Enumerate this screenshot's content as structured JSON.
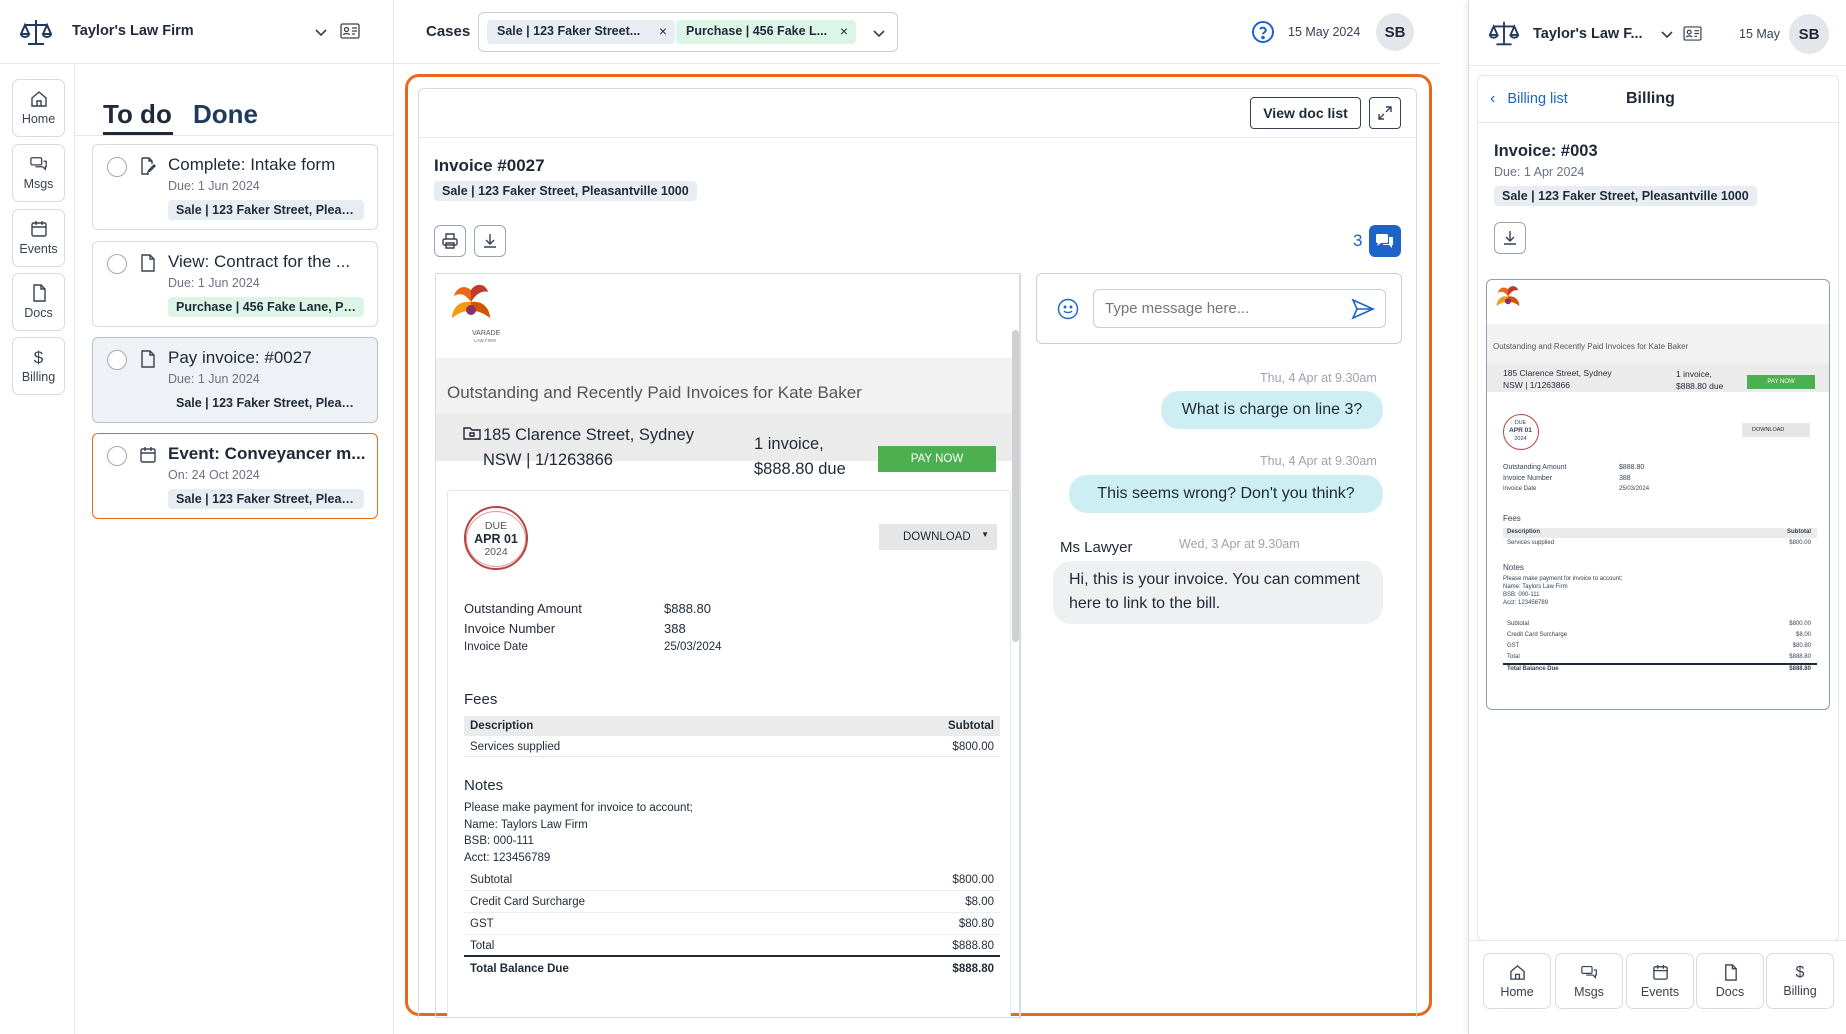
{
  "app": {
    "firm_name": "Taylor's Law Firm",
    "date": "15 May 2024",
    "avatar": "SB"
  },
  "colors": {
    "accent": "#e8691c",
    "brand": "#1f3a5f",
    "link": "#1c64c8",
    "bubble": "#cdeef2",
    "pay": "#4caf50"
  },
  "icons": {
    "logo": "scales-icon",
    "contact": "contact-card-icon",
    "help": "help-circle-icon"
  },
  "header": {
    "cases_label": "Cases",
    "case_chips": [
      {
        "label": "Sale | 123 Faker Street..."
      },
      {
        "label": "Purchase | 456 Fake L..."
      }
    ]
  },
  "nav": {
    "items": [
      {
        "label": "Home"
      },
      {
        "label": "Msgs"
      },
      {
        "label": "Events"
      },
      {
        "label": "Docs"
      },
      {
        "label": "Billing"
      }
    ]
  },
  "todo": {
    "tab_todo": "To do",
    "tab_done": "Done",
    "items": [
      {
        "title": "Complete: Intake form",
        "due": "Due: 1 Jun 2024",
        "tag": "Sale | 123 Faker Street, Pleas..."
      },
      {
        "title": "View: Contract for the ...",
        "due": "Due: 1 Jun 2024",
        "tag": "Purchase | 456 Fake Lane, Pl..."
      },
      {
        "title": "Pay invoice: #0027",
        "due": "Due: 1 Jun 2024",
        "tag": "Sale | 123 Faker Street, Pleas..."
      },
      {
        "title": "Event: Conveyancer m...",
        "due": "On: 24 Oct 2024",
        "tag": "Sale | 123 Faker Street, Pleasa..."
      }
    ]
  },
  "invoice": {
    "view_doc_list": "View doc list",
    "title": "Invoice #0027",
    "tag": "Sale | 123 Faker Street, Pleasantville 1000",
    "comment_count": "3",
    "logo_text": "VARADE",
    "logo_sub": "LAW FIRM",
    "doc": {
      "heading": "Outstanding and Recently Paid Invoices for Kate Baker",
      "address": "185 Clarence Street, Sydney NSW | 1/1263866",
      "summary": "1 invoice, $888.80 due",
      "pay_now": "PAY NOW",
      "due_label": "DUE",
      "due_date": "APR 01",
      "due_year": "2024",
      "download": "DOWNLOAD",
      "outstanding_label": "Outstanding Amount",
      "outstanding_value": "$888.80",
      "invoice_number_label": "Invoice Number",
      "invoice_number_value": "388",
      "invoice_date_label": "Invoice Date",
      "invoice_date_value": "25/03/2024",
      "fees_heading": "Fees",
      "fees_col_desc": "Description",
      "fees_col_sub": "Subtotal",
      "fee_row_desc": "Services supplied",
      "fee_row_value": "$800.00",
      "notes_heading": "Notes",
      "notes_lines": [
        "Please make payment for invoice to account;",
        "Name: Taylors Law Firm",
        "BSB: 000-111",
        "Acct: 123456789"
      ],
      "totals": [
        {
          "label": "Subtotal",
          "value": "$800.00"
        },
        {
          "label": "Credit Card Surcharge",
          "value": "$8.00"
        },
        {
          "label": "GST",
          "value": "$80.80"
        },
        {
          "label": "Total",
          "value": "$888.80"
        }
      ],
      "balance_label": "Total Balance Due",
      "balance_value": "$888.80"
    }
  },
  "chat": {
    "placeholder": "Type message here...",
    "messages": [
      {
        "time": "Thu, 4 Apr at 9.30am",
        "text": "What is charge on line 3?"
      },
      {
        "time": "Thu, 4 Apr at 9.30am",
        "text": "This seems wrong? Don't you think?"
      },
      {
        "sender": "Ms Lawyer",
        "time": "Wed, 3 Apr at 9.30am",
        "text": "Hi, this is your invoice. You can comment here to link to the bill."
      }
    ]
  },
  "mobile": {
    "firm_name": "Taylor's Law F...",
    "date": "15 May",
    "avatar": "SB",
    "back_label": "Billing list",
    "page_title": "Billing",
    "invoice_title": "Invoice: #003",
    "due": "Due: 1 Apr 2024",
    "tag": "Sale | 123 Faker Street, Pleasantville 1000",
    "mini": {
      "heading": "Outstanding and Recently Paid Invoices for Kate Baker",
      "address1": "185 Clarence Street, Sydney",
      "address2": "NSW | 1/1263866",
      "summary1": "1 invoice,",
      "summary2": "$888.80 due",
      "pay_now": "PAY NOW",
      "due_label": "DUE",
      "due_date": "APR 01",
      "due_year": "2024",
      "download": "DOWNLOAD",
      "rows": [
        {
          "label": "Outstanding Amount",
          "value": "$888.80"
        },
        {
          "label": "Invoice Number",
          "value": "388"
        },
        {
          "label": "Invoice Date",
          "value": "25/03/2024"
        }
      ],
      "fees": "Fees",
      "desc": "Description",
      "subtotal": "Subtotal",
      "service": "Services supplied",
      "service_value": "$800.00",
      "notes": "Notes",
      "notes_lines": [
        "Please make payment for invoice to account;",
        "Name: Taylors Law Firm",
        "BSB: 000-111",
        "Acct: 123456789"
      ],
      "totals": [
        {
          "label": "Subtotal",
          "value": "$800.00"
        },
        {
          "label": "Credit Card Surcharge",
          "value": "$8.00"
        },
        {
          "label": "GST",
          "value": "$80.80"
        },
        {
          "label": "Total",
          "value": "$888.80"
        }
      ],
      "balance_label": "Total Balance Due",
      "balance_value": "$888.80"
    },
    "bottom_nav": [
      {
        "label": "Home"
      },
      {
        "label": "Msgs"
      },
      {
        "label": "Events"
      },
      {
        "label": "Docs"
      },
      {
        "label": "Billing"
      }
    ]
  }
}
